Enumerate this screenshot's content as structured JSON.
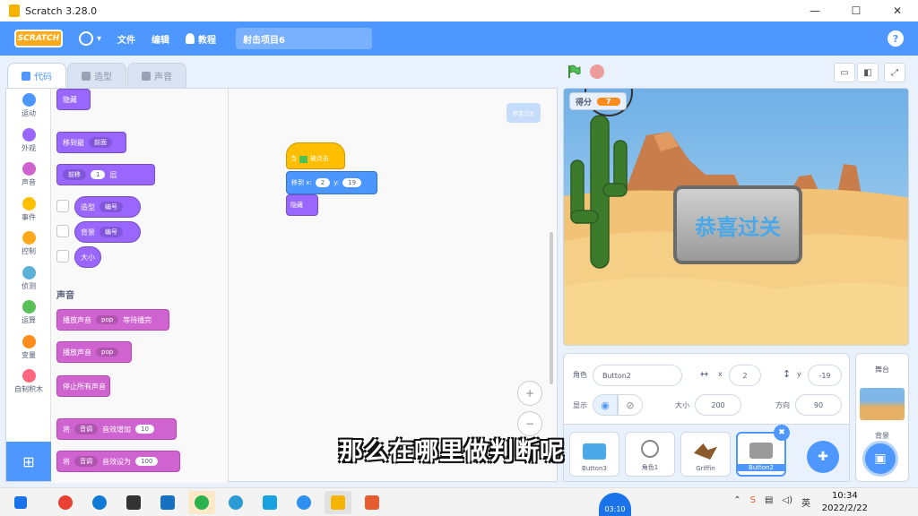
{
  "window": {
    "title": "Scratch 3.28.0",
    "min": "—",
    "max": "☐",
    "close": "✕"
  },
  "menubar": {
    "logo": "SCRATCH",
    "globe_caret": "▾",
    "file": "文件",
    "edit": "编辑",
    "tutorials": "教程",
    "project_name": "射击项目6",
    "help": "?"
  },
  "tabs": {
    "code": "代码",
    "costumes": "造型",
    "sounds": "声音"
  },
  "categories": [
    {
      "label": "运动",
      "color": "#4c97ff"
    },
    {
      "label": "外观",
      "color": "#9966ff"
    },
    {
      "label": "声音",
      "color": "#cf63cf"
    },
    {
      "label": "事件",
      "color": "#ffbf00"
    },
    {
      "label": "控制",
      "color": "#ffab19"
    },
    {
      "label": "侦测",
      "color": "#5cb1d6"
    },
    {
      "label": "运算",
      "color": "#59c059"
    },
    {
      "label": "变量",
      "color": "#ff8c1a"
    },
    {
      "label": "自制积木",
      "color": "#ff6680"
    }
  ],
  "palette": {
    "hide": "隐藏",
    "goto_layer": "移到最",
    "goto_layer_opt": "前面",
    "go_layers_opt": "前移",
    "go_layers_num": "1",
    "go_layers_suffix": "层",
    "costume_reporter": "造型",
    "costume_opt": "编号",
    "backdrop_reporter": "背景",
    "backdrop_opt": "编号",
    "size_reporter": "大小",
    "sound_header": "声音",
    "play_until_done": "播放声音",
    "play_until_done_opt": "pop",
    "play_until_done_suffix": "等待播完",
    "start_sound": "播放声音",
    "start_sound_opt": "pop",
    "stop_all_sounds": "停止所有声音",
    "change_effect": "将",
    "change_effect_opt": "音调",
    "change_effect_mid": "音效增加",
    "change_effect_num": "10",
    "set_effect": "将",
    "set_effect_opt": "音调",
    "set_effect_mid": "音效设为",
    "set_effect_num": "100"
  },
  "script": {
    "hat_prefix": "当",
    "hat_suffix": "被点击",
    "goto_label": "移到 x:",
    "goto_x": "2",
    "goto_y_label": "y:",
    "goto_y": "19",
    "hide": "隐藏",
    "sprite_badge": "恭喜过关",
    "zoom_in": "+",
    "zoom_out": "−"
  },
  "stage": {
    "score_label": "得分",
    "score_value": "7",
    "banner_text": "恭喜过关",
    "layout_icons": [
      "▭",
      "◧",
      "⤢"
    ]
  },
  "sprite_info": {
    "sprite_label": "角色",
    "sprite_name": "Button2",
    "x_label": "x",
    "x_value": "2",
    "y_label": "y",
    "y_value": "-19",
    "show_label": "显示",
    "size_label": "大小",
    "size_value": "200",
    "direction_label": "方向",
    "direction_value": "90"
  },
  "sprites": [
    {
      "name": "Button3",
      "thumb_color": "#4aa8e8"
    },
    {
      "name": "角色1",
      "thumb_color": "#d0d0d0"
    },
    {
      "name": "Griffin",
      "thumb_color": "#8a5a2a"
    },
    {
      "name": "Button2",
      "thumb_color": "#9a9a9a"
    }
  ],
  "stage_panel": {
    "title": "舞台",
    "backdrops_label": "背景"
  },
  "subtitle": "那么在哪里做判断呢",
  "taskbar": {
    "timer": "03:10",
    "time": "10:34",
    "date": "2022/2/22",
    "lang": "英",
    "icons": [
      {
        "name": "windows",
        "color": "#1a73e8"
      },
      {
        "name": "chrome",
        "color": "#e94235"
      },
      {
        "name": "edge",
        "color": "#0f7bd6"
      },
      {
        "name": "store",
        "color": "#333333"
      },
      {
        "name": "mail",
        "color": "#1572c2"
      },
      {
        "name": "wechat",
        "color": "#2bb24c"
      },
      {
        "name": "ie",
        "color": "#2b9bd6"
      },
      {
        "name": "app-m",
        "color": "#1aa1e0"
      },
      {
        "name": "qq-chat",
        "color": "#2e8ff0"
      },
      {
        "name": "scratch",
        "color": "#f5b400"
      },
      {
        "name": "x-app",
        "color": "#e65c2e"
      }
    ]
  }
}
